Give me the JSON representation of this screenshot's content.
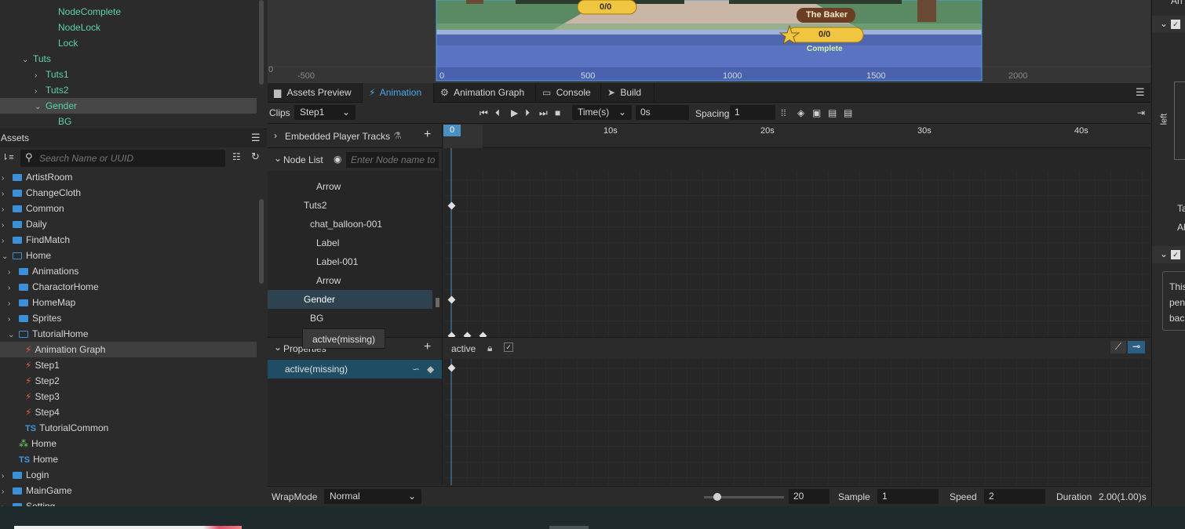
{
  "hierarchy": {
    "items": [
      {
        "label": "NodeComplete",
        "indent": 74,
        "caret": ""
      },
      {
        "label": "NodeLock",
        "indent": 74,
        "caret": ""
      },
      {
        "label": "Lock",
        "indent": 74,
        "caret": ""
      },
      {
        "label": "Tuts",
        "indent": 42,
        "caret": "⌄"
      },
      {
        "label": "Tuts1",
        "indent": 58,
        "caret": "›"
      },
      {
        "label": "Tuts2",
        "indent": 58,
        "caret": "›"
      },
      {
        "label": "Gender",
        "indent": 58,
        "caret": "⌄"
      },
      {
        "label": "BG",
        "indent": 74,
        "caret": ""
      }
    ]
  },
  "assets": {
    "title": "Assets",
    "search_placeholder": "Search Name or UUID",
    "items": [
      {
        "label": "ArtistRoom",
        "type": "folder",
        "indent": 14,
        "caret": "›"
      },
      {
        "label": "ChangeCloth",
        "type": "folder",
        "indent": 14,
        "caret": "›"
      },
      {
        "label": "Common",
        "type": "folder",
        "indent": 14,
        "caret": "›"
      },
      {
        "label": "Daily",
        "type": "folder",
        "indent": 14,
        "caret": "›"
      },
      {
        "label": "FindMatch",
        "type": "folder",
        "indent": 14,
        "caret": "›"
      },
      {
        "label": "Home",
        "type": "folder-open",
        "indent": 14,
        "caret": "⌄"
      },
      {
        "label": "Animations",
        "type": "folder",
        "indent": 22,
        "caret": "›"
      },
      {
        "label": "CharactorHome",
        "type": "folder",
        "indent": 22,
        "caret": "›"
      },
      {
        "label": "HomeMap",
        "type": "folder",
        "indent": 22,
        "caret": "›"
      },
      {
        "label": "Sprites",
        "type": "folder",
        "indent": 22,
        "caret": "›"
      },
      {
        "label": "TutorialHome",
        "type": "folder-open",
        "indent": 22,
        "caret": "⌄"
      },
      {
        "label": "Animation Graph",
        "type": "anim",
        "indent": 30,
        "caret": ""
      },
      {
        "label": "Step1",
        "type": "anim",
        "indent": 30,
        "caret": ""
      },
      {
        "label": "Step2",
        "type": "anim",
        "indent": 30,
        "caret": ""
      },
      {
        "label": "Step3",
        "type": "anim",
        "indent": 30,
        "caret": ""
      },
      {
        "label": "Step4",
        "type": "anim",
        "indent": 30,
        "caret": ""
      },
      {
        "label": "TutorialCommon",
        "type": "ts",
        "indent": 30,
        "caret": ""
      },
      {
        "label": "Home",
        "type": "prefab",
        "indent": 22,
        "caret": ""
      },
      {
        "label": "Home",
        "type": "ts",
        "indent": 22,
        "caret": ""
      },
      {
        "label": "Login",
        "type": "folder",
        "indent": 14,
        "caret": "›"
      },
      {
        "label": "MainGame",
        "type": "folder",
        "indent": 14,
        "caret": "›"
      },
      {
        "label": "Setting",
        "type": "folder",
        "indent": 14,
        "caret": "›"
      }
    ]
  },
  "scene": {
    "counter_left": "0/0",
    "counter_right": "0/0",
    "name_tag": "The Baker",
    "complete_label": "Complete",
    "axis_labels": [
      "0",
      "-500",
      "0",
      "500",
      "1000",
      "1500",
      "2000"
    ]
  },
  "tabs": [
    "Assets Preview",
    "Animation",
    "Animation Graph",
    "Console",
    "Build"
  ],
  "anim_toolbar": {
    "clips_label": "Clips",
    "clip_value": "Step1",
    "time_mode": "Time(s)",
    "time_value": "0s",
    "spacing_label": "Spacing",
    "spacing_value": "1"
  },
  "tracks": {
    "embedded_label": "Embedded Player Tracks",
    "node_list_label": "Node List",
    "node_filter_placeholder": "Enter Node name to",
    "nodes": [
      "Arrow",
      "Tuts2",
      "chat_balloon-001",
      "Label",
      "Label-001",
      "Arrow",
      "Gender",
      "BG"
    ],
    "properties_label": "Properties",
    "tooltip": "active(missing)",
    "property_row": "active(missing)",
    "property_name": "active"
  },
  "ruler": {
    "labels": [
      "0",
      "10s",
      "20s",
      "30s",
      "40s"
    ]
  },
  "bottom": {
    "wrapmode_label": "WrapMode",
    "wrapmode_value": "Normal",
    "zoom_value": "20",
    "sample_label": "Sample",
    "sample_value": "1",
    "speed_label": "Speed",
    "speed_value": "2",
    "duration_label": "Duration",
    "duration_value": "2.00(1.00)s"
  },
  "inspector": {
    "snippets": [
      "This",
      "pend",
      "back"
    ],
    "left_label": "left",
    "ta": "Ta",
    "al": "Al",
    "an": "An"
  }
}
